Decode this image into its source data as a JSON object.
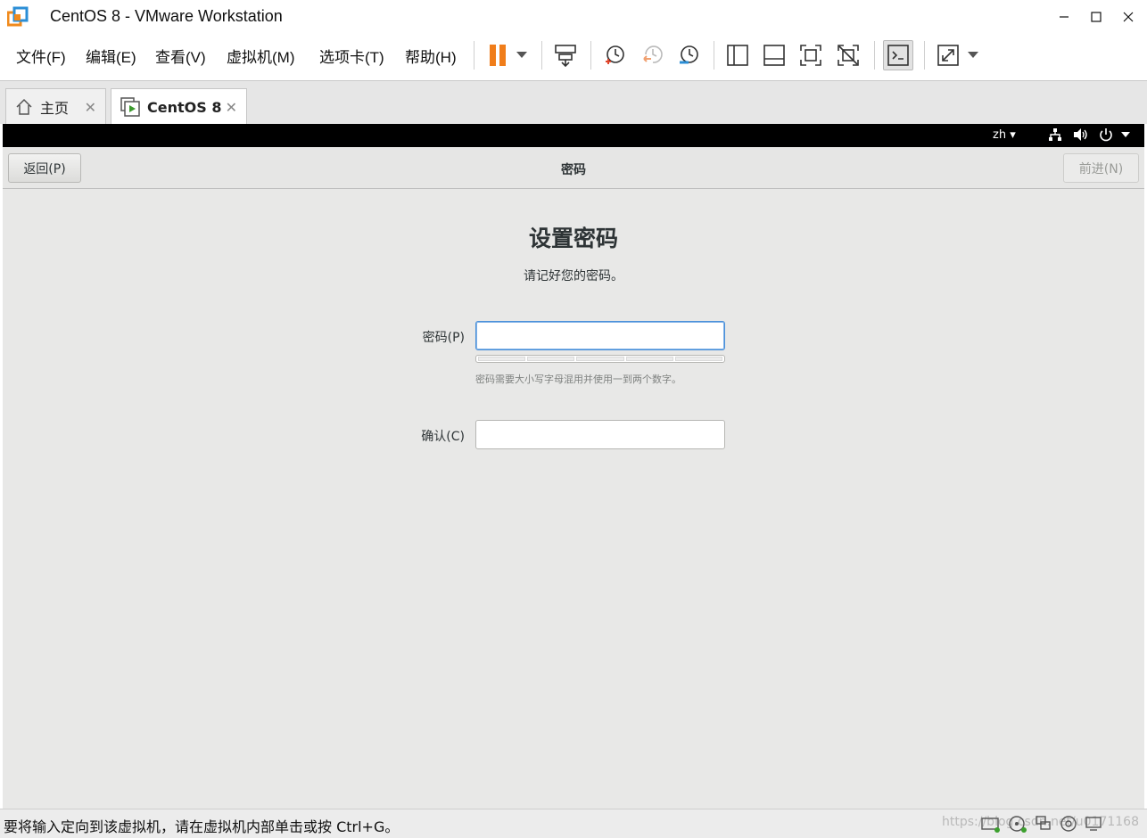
{
  "window": {
    "title": "CentOS 8 - VMware Workstation",
    "minimize_glyph": "—",
    "close_glyph": "✕"
  },
  "menu": [
    "文件(F)",
    "编辑(E)",
    "查看(V)",
    "虚拟机(M)",
    "选项卡(T)",
    "帮助(H)"
  ],
  "toolbar": {
    "icons": [
      "pause-icon",
      "dropdown-icon",
      "send-ctrl-alt-del-icon",
      "take-snapshot-icon",
      "revert-snapshot-icon",
      "snapshot-manager-icon",
      "library-view-icon",
      "thumbnail-view-icon",
      "fullscreen-icon",
      "unity-icon",
      "console-view-icon",
      "stretch-icon",
      "dropdown-icon"
    ],
    "accent": "#f07d1a"
  },
  "tabs": [
    {
      "label": "主页",
      "icon": "home-icon",
      "active": false
    },
    {
      "label": "CentOS 8",
      "icon": "vm-running-icon",
      "active": true
    }
  ],
  "gnome_top": {
    "language": "zh"
  },
  "headerbar": {
    "back_label": "返回(P)",
    "title": "密码",
    "next_label": "前进(N)"
  },
  "page": {
    "title": "设置密码",
    "subtitle": "请记好您的密码。",
    "password_label": "密码(P)",
    "password_value": "",
    "hint": "密码需要大小写字母混用并使用一到两个数字。",
    "confirm_label": "确认(C)",
    "confirm_value": "",
    "focus_color": "#4a90d9"
  },
  "statusbar": {
    "message": "要将输入定向到该虚拟机，请在虚拟机内部单击或按 Ctrl+G。",
    "watermark": "https://blog.csdn.net/u0171168"
  }
}
